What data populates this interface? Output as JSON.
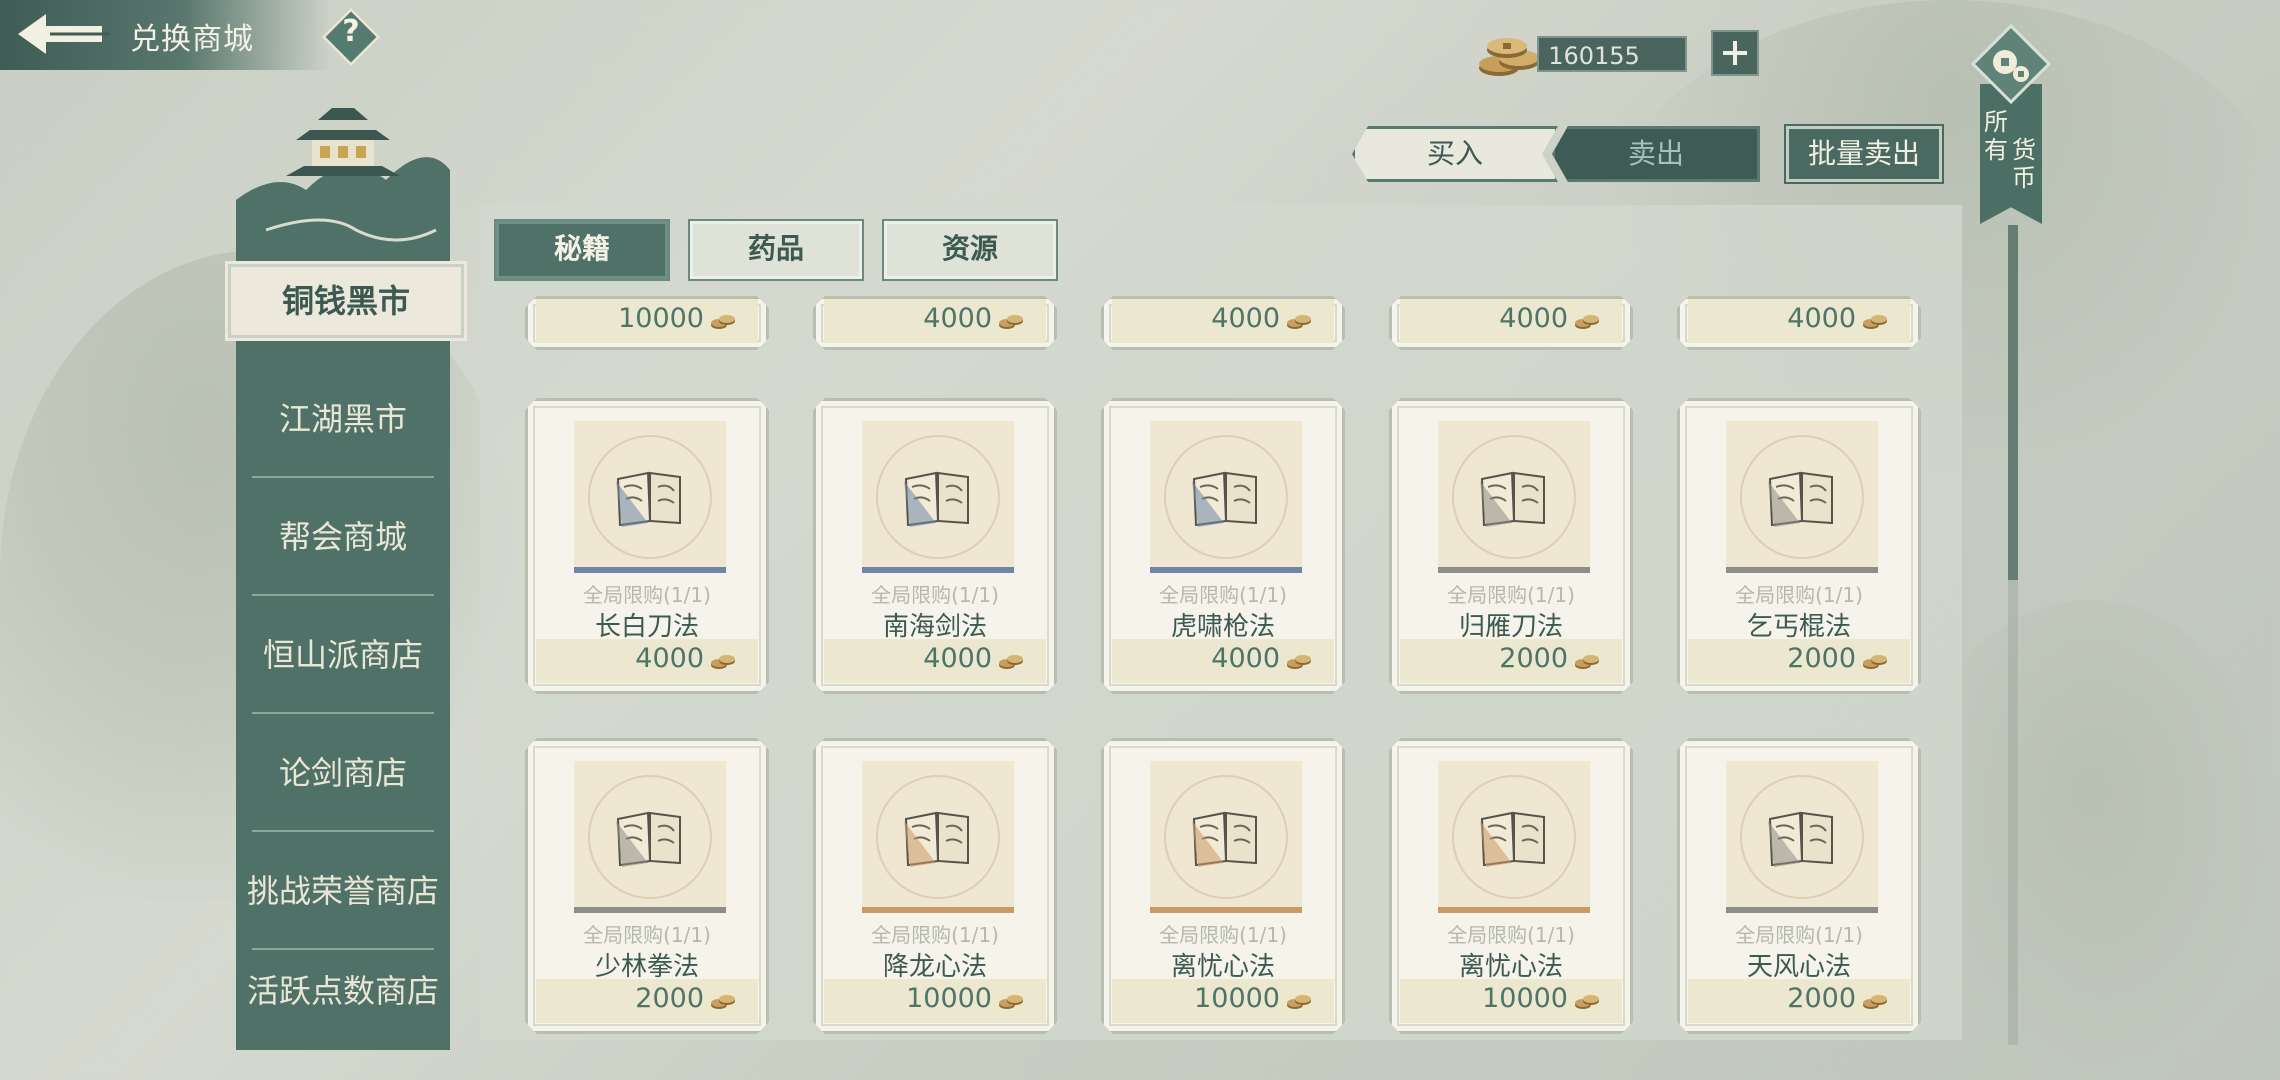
{
  "header": {
    "title": "兑换商城",
    "back_icon": "back-arrow-icon",
    "help_label": "?"
  },
  "currency": {
    "amount": "160155",
    "icon": "copper-coin-icon",
    "add_icon": "plus-icon"
  },
  "trade": {
    "buy_label": "买入",
    "sell_label": "卖出",
    "bulk_sell_label": "批量卖出",
    "active": "buy"
  },
  "all_currency": {
    "line1": "所有",
    "line2": "货币"
  },
  "sidebar": {
    "items": [
      {
        "label": "铜钱黑市",
        "active": true
      },
      {
        "label": "江湖黑市",
        "active": false
      },
      {
        "label": "帮会商城",
        "active": false
      },
      {
        "label": "恒山派商店",
        "active": false
      },
      {
        "label": "论剑商店",
        "active": false
      },
      {
        "label": "挑战荣誉商店",
        "active": false
      },
      {
        "label": "活跃点数商店",
        "active": false
      }
    ]
  },
  "tabs": [
    {
      "label": "秘籍",
      "active": true
    },
    {
      "label": "药品",
      "active": false
    },
    {
      "label": "资源",
      "active": false
    }
  ],
  "top_row_prices": [
    "10000",
    "4000",
    "4000",
    "4000",
    "4000"
  ],
  "items": [
    {
      "name": "长白刀法",
      "limit": "全局限购(1/1)",
      "price": "4000",
      "rarity": "blue"
    },
    {
      "name": "南海剑法",
      "limit": "全局限购(1/1)",
      "price": "4000",
      "rarity": "blue"
    },
    {
      "name": "虎啸枪法",
      "limit": "全局限购(1/1)",
      "price": "4000",
      "rarity": "blue"
    },
    {
      "name": "归雁刀法",
      "limit": "全局限购(1/1)",
      "price": "2000",
      "rarity": "gray"
    },
    {
      "name": "乞丐棍法",
      "limit": "全局限购(1/1)",
      "price": "2000",
      "rarity": "gray"
    },
    {
      "name": "少林拳法",
      "limit": "全局限购(1/1)",
      "price": "2000",
      "rarity": "gray"
    },
    {
      "name": "降龙心法",
      "limit": "全局限购(1/1)",
      "price": "10000",
      "rarity": "orange"
    },
    {
      "name": "离忧心法",
      "limit": "全局限购(1/1)",
      "price": "10000",
      "rarity": "orange"
    },
    {
      "name": "离忧心法",
      "limit": "全局限购(1/1)",
      "price": "10000",
      "rarity": "orange"
    },
    {
      "name": "天风心法",
      "limit": "全局限购(1/1)",
      "price": "2000",
      "rarity": "gray"
    }
  ],
  "colors": {
    "blue": "#6f86a8",
    "gray": "#8e8e88",
    "orange": "#c99a68",
    "accent": "#4f7167"
  }
}
